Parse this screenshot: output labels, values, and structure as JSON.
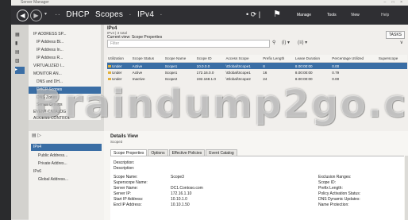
{
  "window": {
    "title": "Server Manager",
    "controls": "– □ ×"
  },
  "nav": {
    "breadcrumb": [
      "DHCP",
      "Scopes",
      "IPv4"
    ],
    "refresh_icon": "refresh-icon",
    "flag_icon": "flag-icon",
    "menu": [
      "Manage",
      "Tools",
      "View"
    ]
  },
  "sidebar": {
    "tree": [
      "IP ADDRESS SP...",
      "IP Address Bl...",
      "IP Address In...",
      "IP Address R...",
      "VIRTUALIZED I...",
      "MONITOR AN...",
      "DNS and DH...",
      "DHCP Scopes",
      "DNS Zones",
      "Server Groups",
      "EVENT CATALOG",
      "ACCESS CONTROL"
    ],
    "lower": {
      "ipv4": "IPv4",
      "public": "Public Address...",
      "private": "Private Addres...",
      "ipv6": "IPv6",
      "global": "Global Address..."
    }
  },
  "scopes": {
    "heading": "IPv4",
    "subheading": "IPv4 | 3 total",
    "current_view": "Current view:  Scope Properties",
    "tasks": "TASKS",
    "filter_placeholder": "Filter",
    "columns": [
      "Utilization",
      "Scope Status",
      "Scope Name",
      "Scope ID",
      "Access Scope",
      "Prefix Length",
      "Lease Duration",
      "Percentage Utilized",
      "Superscope"
    ],
    "rows": [
      [
        "Under",
        "Active",
        "Scope1",
        "10.0.0.0",
        "\\Global\\Scope1",
        "8",
        "8.00:00:00",
        "0.00",
        ""
      ],
      [
        "Under",
        "Active",
        "Scope1",
        "172.16.0.0",
        "\\Global\\Scope1",
        "16",
        "8.00:00:00",
        "0.79",
        ""
      ],
      [
        "Under",
        "Inactive",
        "Scope2",
        "192.168.1.0",
        "\\Global\\Scope2",
        "24",
        "8.00:00:00",
        "0.00",
        ""
      ]
    ]
  },
  "details": {
    "title": "Details View",
    "subtitle": "Scope3",
    "tabs": [
      "Scope Properties",
      "Options",
      "Effective Policies",
      "Event Catalog"
    ],
    "left": [
      [
        "Description:",
        ""
      ],
      [
        "Description:",
        ""
      ],
      [
        "Scope Name:",
        "Scope3"
      ],
      [
        "Superscope Name:",
        ""
      ],
      [
        "Server Name:",
        "DC1.Contoso.com"
      ],
      [
        "Server IP:",
        "172.16.1.10"
      ],
      [
        "Start IP Address:",
        "10.10.1.0"
      ],
      [
        "End IP Address:",
        "10.10.1.50"
      ]
    ],
    "right": [
      [
        "Exclusion Ranges:",
        ""
      ],
      [
        "Scope ID:",
        ""
      ],
      [
        "Prefix Length:",
        ""
      ],
      [
        "Policy Activation Status:",
        ""
      ],
      [
        "DNS Dynamic Updates:",
        ""
      ],
      [
        "Name Protection:",
        ""
      ]
    ]
  },
  "watermark": "Braindump2go.com",
  "colors": {
    "nav": "#2f2f33",
    "selection": "#3a6ea5",
    "bg": "#e9e7e2"
  }
}
